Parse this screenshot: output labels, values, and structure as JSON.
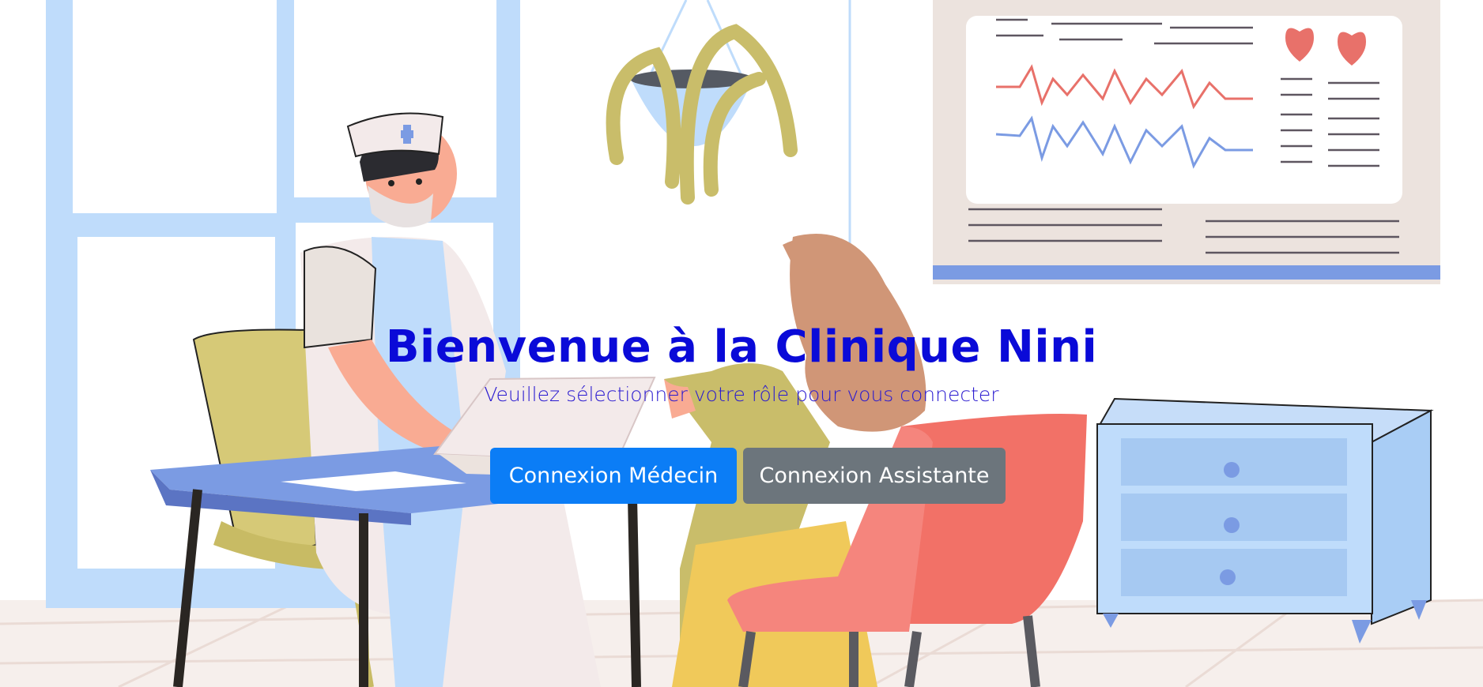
{
  "welcome": {
    "title": "Bienvenue à la Clinique Nini",
    "subtitle": "Veuillez sélectionner votre rôle pour vous connecter"
  },
  "buttons": {
    "doctor_login": "Connexion Médecin",
    "assistant_login": "Connexion Assistante"
  },
  "colors": {
    "title": "#0a0ad8",
    "primary_button": "#0b7df6",
    "secondary_button": "#6c757c"
  },
  "illustration": {
    "icons": [
      "window",
      "hanging-plant",
      "heart-monitor-poster",
      "doctor",
      "patient",
      "desk",
      "laptop",
      "chair",
      "drawer-cabinet"
    ]
  }
}
